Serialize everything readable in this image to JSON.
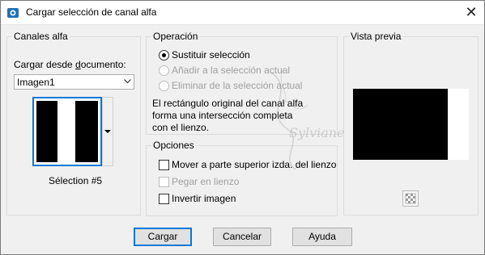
{
  "window": {
    "title": "Cargar selección de canal alfa",
    "close_glyph": "✕"
  },
  "canales": {
    "group_title": "Canales alfa",
    "source_label": "Cargar desde documento:",
    "source_value": "Imagen1",
    "selection_name": "Sélection #5"
  },
  "operacion": {
    "group_title": "Operación",
    "options": [
      {
        "label": "Sustituir selección",
        "checked": true,
        "enabled": true
      },
      {
        "label": "Añadir a la selección actual",
        "checked": false,
        "enabled": false
      },
      {
        "label": "Eliminar de la selección actual",
        "checked": false,
        "enabled": false
      }
    ],
    "description": "El rectángulo original del canal alfa forma una intersección completa con el lienzo."
  },
  "opciones": {
    "group_title": "Opciones",
    "checks": [
      {
        "label": "Mover a parte superior izda. del lienzo",
        "checked": false,
        "enabled": true
      },
      {
        "label": "Pegar en lienzo",
        "checked": false,
        "enabled": false
      },
      {
        "label": "Invertir imagen",
        "checked": false,
        "enabled": true
      }
    ]
  },
  "preview": {
    "group_title": "Vista previa"
  },
  "buttons": {
    "ok": "Cargar",
    "cancel": "Cancelar",
    "help": "Ayuda"
  },
  "watermark": {
    "text": "Sylviane"
  },
  "colors": {
    "accent": "#0078d7",
    "window_bg": "#f0f0f0"
  },
  "icons": [
    "app-icon",
    "close-icon",
    "dropdown-arrow-icon",
    "checkerboard-icon"
  ]
}
